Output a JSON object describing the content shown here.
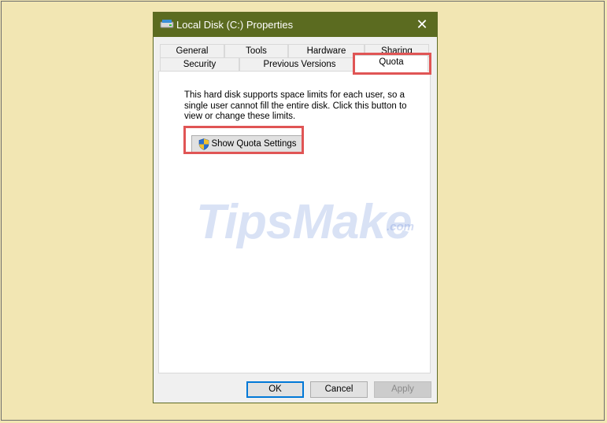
{
  "window": {
    "title": "Local Disk (C:) Properties",
    "close_glyph": "✕"
  },
  "tabs": {
    "row_back": [
      "General",
      "Tools",
      "Hardware",
      "Sharing"
    ],
    "row_front": [
      "Security",
      "Previous Versions",
      "Quota"
    ],
    "selected": "Quota"
  },
  "quota": {
    "description": "This hard disk supports space limits for each user, so a single user cannot fill the entire disk. Click this button to view or change these limits.",
    "button_label": "Show Quota Settings"
  },
  "watermark": {
    "main": "TipsMake",
    "suffix": ".com"
  },
  "footer": {
    "ok_label": "OK",
    "cancel_label": "Cancel",
    "apply_label": "Apply"
  },
  "colors": {
    "titlebar": "#5b6b20",
    "page_background": "#f2e6b3",
    "highlight_border": "#e05555",
    "default_button_border": "#0078d7"
  }
}
